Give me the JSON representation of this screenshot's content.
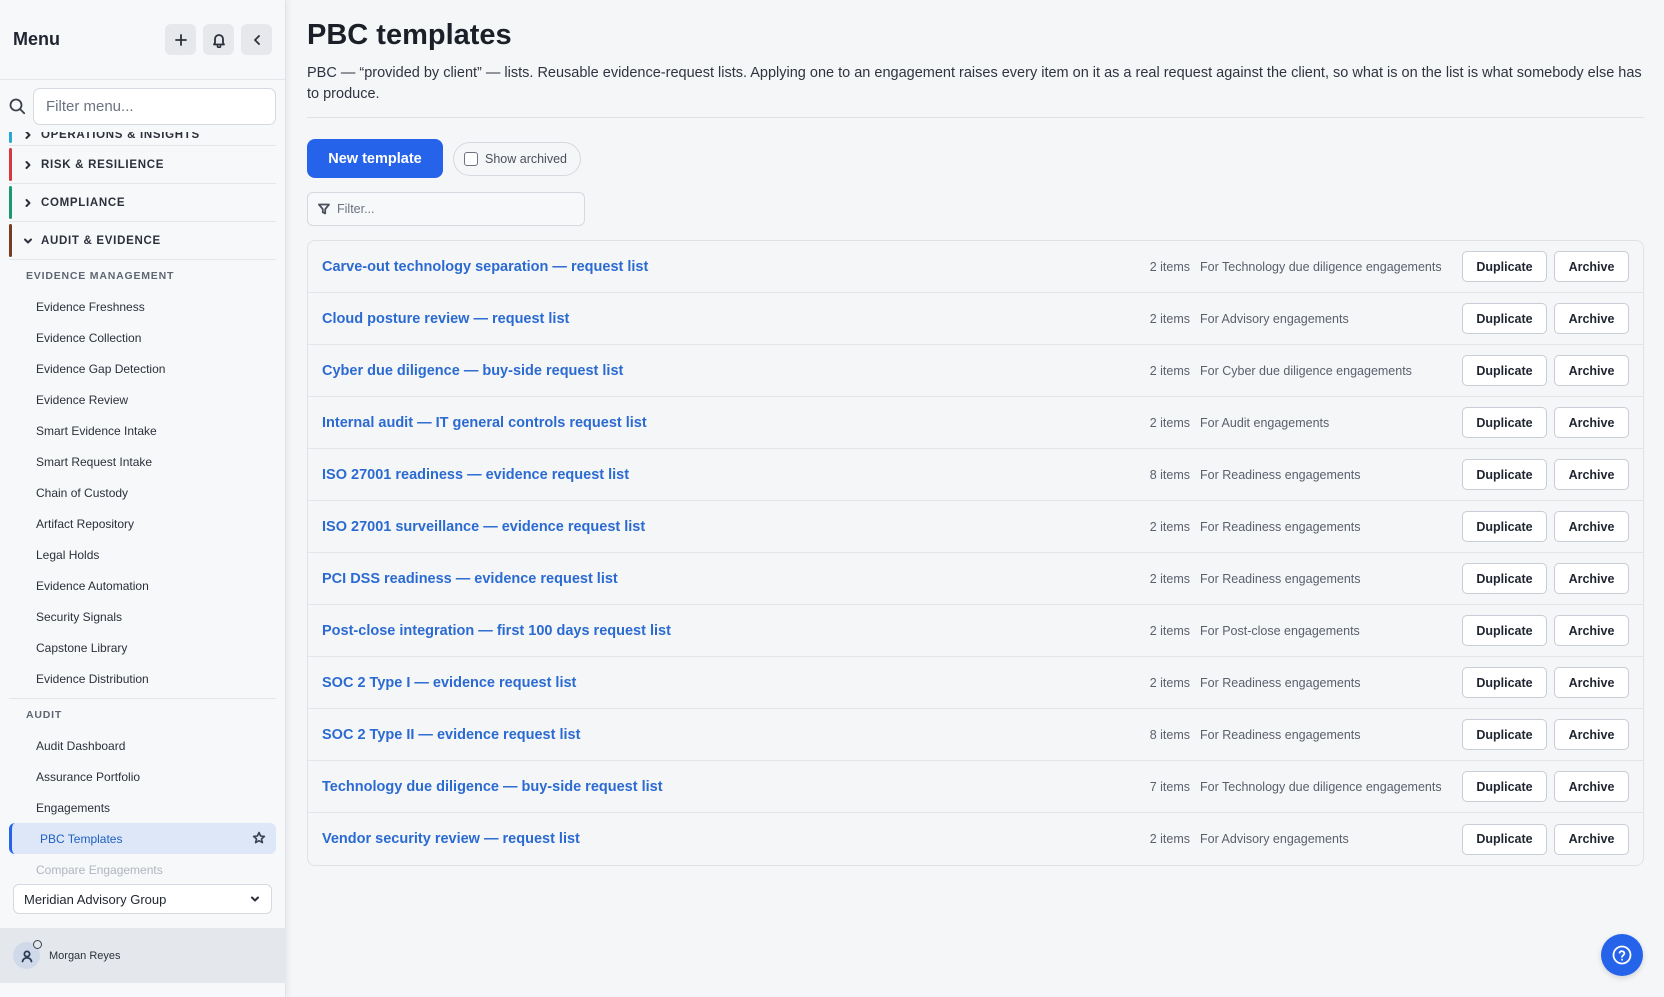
{
  "sidebar": {
    "title": "Menu",
    "filter_placeholder": "Filter menu...",
    "sections": [
      {
        "label": "OPERATIONS & INSIGHTS",
        "color": "#2aa7d9",
        "expanded": false
      },
      {
        "label": "RISK & RESILIENCE",
        "color": "#d9363e",
        "expanded": false
      },
      {
        "label": "COMPLIANCE",
        "color": "#1a9a6c",
        "expanded": false
      },
      {
        "label": "AUDIT & EVIDENCE",
        "color": "#7a3b1f",
        "expanded": true
      }
    ],
    "groups": {
      "evidence_management": {
        "label": "EVIDENCE MANAGEMENT",
        "items": [
          "Evidence Freshness",
          "Evidence Collection",
          "Evidence Gap Detection",
          "Evidence Review",
          "Smart Evidence Intake",
          "Smart Request Intake",
          "Chain of Custody",
          "Artifact Repository",
          "Legal Holds",
          "Evidence Automation",
          "Security Signals",
          "Capstone Library",
          "Evidence Distribution"
        ]
      },
      "audit": {
        "label": "AUDIT",
        "items": [
          "Audit Dashboard",
          "Assurance Portfolio",
          "Engagements"
        ],
        "active": "PBC Templates",
        "faded": "Compare Engagements"
      }
    },
    "organization": "Meridian Advisory Group",
    "user": "Morgan Reyes"
  },
  "main": {
    "title": "PBC templates",
    "description": "PBC — “provided by client” — lists. Reusable evidence-request lists. Applying one to an engagement raises every item on it as a real request against the client, so what is on the list is what somebody else has to produce.",
    "new_button": "New template",
    "show_archived": "Show archived",
    "filter_placeholder": "Filter...",
    "duplicate_label": "Duplicate",
    "archive_label": "Archive",
    "templates": [
      {
        "name": "Carve-out technology separation — request list",
        "count": "2 items",
        "for": "For Technology due diligence engagements"
      },
      {
        "name": "Cloud posture review — request list",
        "count": "2 items",
        "for": "For Advisory engagements"
      },
      {
        "name": "Cyber due diligence — buy-side request list",
        "count": "2 items",
        "for": "For Cyber due diligence engagements"
      },
      {
        "name": "Internal audit — IT general controls request list",
        "count": "2 items",
        "for": "For Audit engagements"
      },
      {
        "name": "ISO 27001 readiness — evidence request list",
        "count": "8 items",
        "for": "For Readiness engagements"
      },
      {
        "name": "ISO 27001 surveillance — evidence request list",
        "count": "2 items",
        "for": "For Readiness engagements"
      },
      {
        "name": "PCI DSS readiness — evidence request list",
        "count": "2 items",
        "for": "For Readiness engagements"
      },
      {
        "name": "Post-close integration — first 100 days request list",
        "count": "2 items",
        "for": "For Post-close engagements"
      },
      {
        "name": "SOC 2 Type I — evidence request list",
        "count": "2 items",
        "for": "For Readiness engagements"
      },
      {
        "name": "SOC 2 Type II — evidence request list",
        "count": "8 items",
        "for": "For Readiness engagements"
      },
      {
        "name": "Technology due diligence — buy-side request list",
        "count": "7 items",
        "for": "For Technology due diligence engagements"
      },
      {
        "name": "Vendor security review — request list",
        "count": "2 items",
        "for": "For Advisory engagements"
      }
    ]
  },
  "icons": {
    "add": "plus-icon",
    "notifications": "bell-icon",
    "collapse": "chevron-left-icon",
    "search": "search-icon",
    "filter": "funnel-icon",
    "favorite": "star-icon",
    "help": "question-circle-icon"
  },
  "colors": {
    "accent": "#2563eb",
    "link": "#2b6bd1"
  }
}
